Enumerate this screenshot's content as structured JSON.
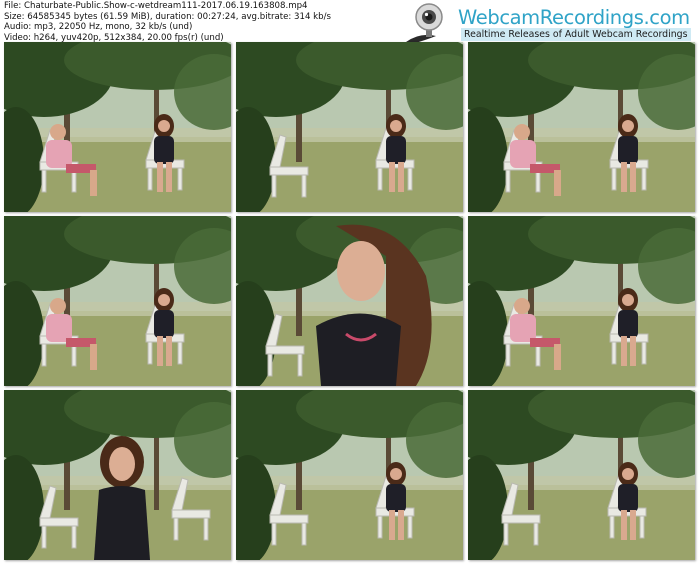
{
  "file_info": {
    "file": "File: Chaturbate-Public.Show-c-wetdream111-2017.06.19.163808.mp4",
    "size": "Size: 64585345 bytes (61.59 MiB), duration: 00:27:24, avg.bitrate: 314 kb/s",
    "audio": "Audio: mp3, 22050 Hz, mono, 32 kb/s (und)",
    "video": "Video: h264, yuv420p, 512x384, 20.00 fps(r) (und)"
  },
  "logo": {
    "brand": "WebcamRecordings.com",
    "tagline": "Realtime Releases of Adult Webcam Recordings",
    "icon": "webcam-icon"
  },
  "colors": {
    "brand_blue": "#2fa3c7",
    "tagline_bg": "#cfeaf4",
    "foliage": "#2d4a22",
    "grass": "#9aa36a",
    "chair": "#e9e9e3"
  },
  "thumbnails": [
    {
      "scene": "two-seated"
    },
    {
      "scene": "woman-seated-empty-chair"
    },
    {
      "scene": "two-seated"
    },
    {
      "scene": "two-seated"
    },
    {
      "scene": "closeup"
    },
    {
      "scene": "two-seated"
    },
    {
      "scene": "woman-standing"
    },
    {
      "scene": "woman-seated-empty-chair"
    },
    {
      "scene": "woman-seated-empty-chair"
    }
  ]
}
